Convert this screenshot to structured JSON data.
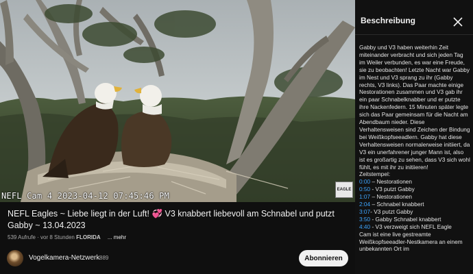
{
  "video": {
    "overlay_timestamp": "NEFL Cam 4 2023-04-12 07:45:46 PM",
    "logo_text": "EAGLE"
  },
  "info": {
    "title_part1": "NEFL Eagles ~ Liebe liegt in der Luft! ",
    "title_emoji": "💞",
    "title_part2": " V3 knabbert liebevoll am Schnabel und putzt Gabby ~ 13.04.2023",
    "views": "539 Aufrufe",
    "age": "vor 8 Stunden",
    "location": "FLORIDA",
    "more_label": "... mehr",
    "channel_name": "Vogelkamera-Netzwerk",
    "subscriber_count": "889",
    "subscribe_label": "Abonnieren"
  },
  "panel": {
    "title": "Beschreibung",
    "description": "Gabby und V3 haben weiterhin Zeit miteinander verbracht und sich jeden Tag im Weiler verbunden, es war eine Freude, sie zu beobachten! Letzte Nacht war Gabby im Nest und V3 sprang zu ihr (Gabby rechts, V3 links). Das Paar machte einige Nestorationen zusammen und V3 gab ihr ein paar Schnabelknabber und er putzte ihre Nackenfedern. 15 Minuten später legte sich das Paar gemeinsam für die Nacht am Abendbaum nieder. Diese Verhaltensweisen sind Zeichen der Bindung bei Weißkopfseeadlern. Gabby hat diese Verhaltensweisen normalerweise initiiert, da V3 ein unerfahrener junger Mann ist, also ist es großartig zu sehen, dass V3 sich wohl fühlt, es mit ihr zu initiieren!",
    "timestamps_label": "Zeitstempel:",
    "timestamps": [
      {
        "time": "0:00",
        "text": " – Nestorationen"
      },
      {
        "time": "0:50",
        "text": " - V3 putzt Gabby"
      },
      {
        "time": "1:07",
        "text": " – Nestorationen"
      },
      {
        "time": "2:04",
        "text": " – Schnabel knabbert"
      },
      {
        "time": "3:07",
        "text": "- V3 putzt Gabby"
      },
      {
        "time": "3:50",
        "text": " - Gabby Schnabel knabbert"
      },
      {
        "time": "4:40",
        "text": " - V3 verzweigt sich NEFL Eagle"
      }
    ],
    "footer": "Cam ist eine live gestreamte Weißkopfseeadler-Nestkamera an einem unbekannten Ort im"
  },
  "icons": {
    "close": "close-icon",
    "heart": "two-hearts-emoji"
  },
  "colors": {
    "background": "#0f0f0f",
    "link": "#3ea6ff",
    "subscribe_bg": "#f1f1f1"
  }
}
